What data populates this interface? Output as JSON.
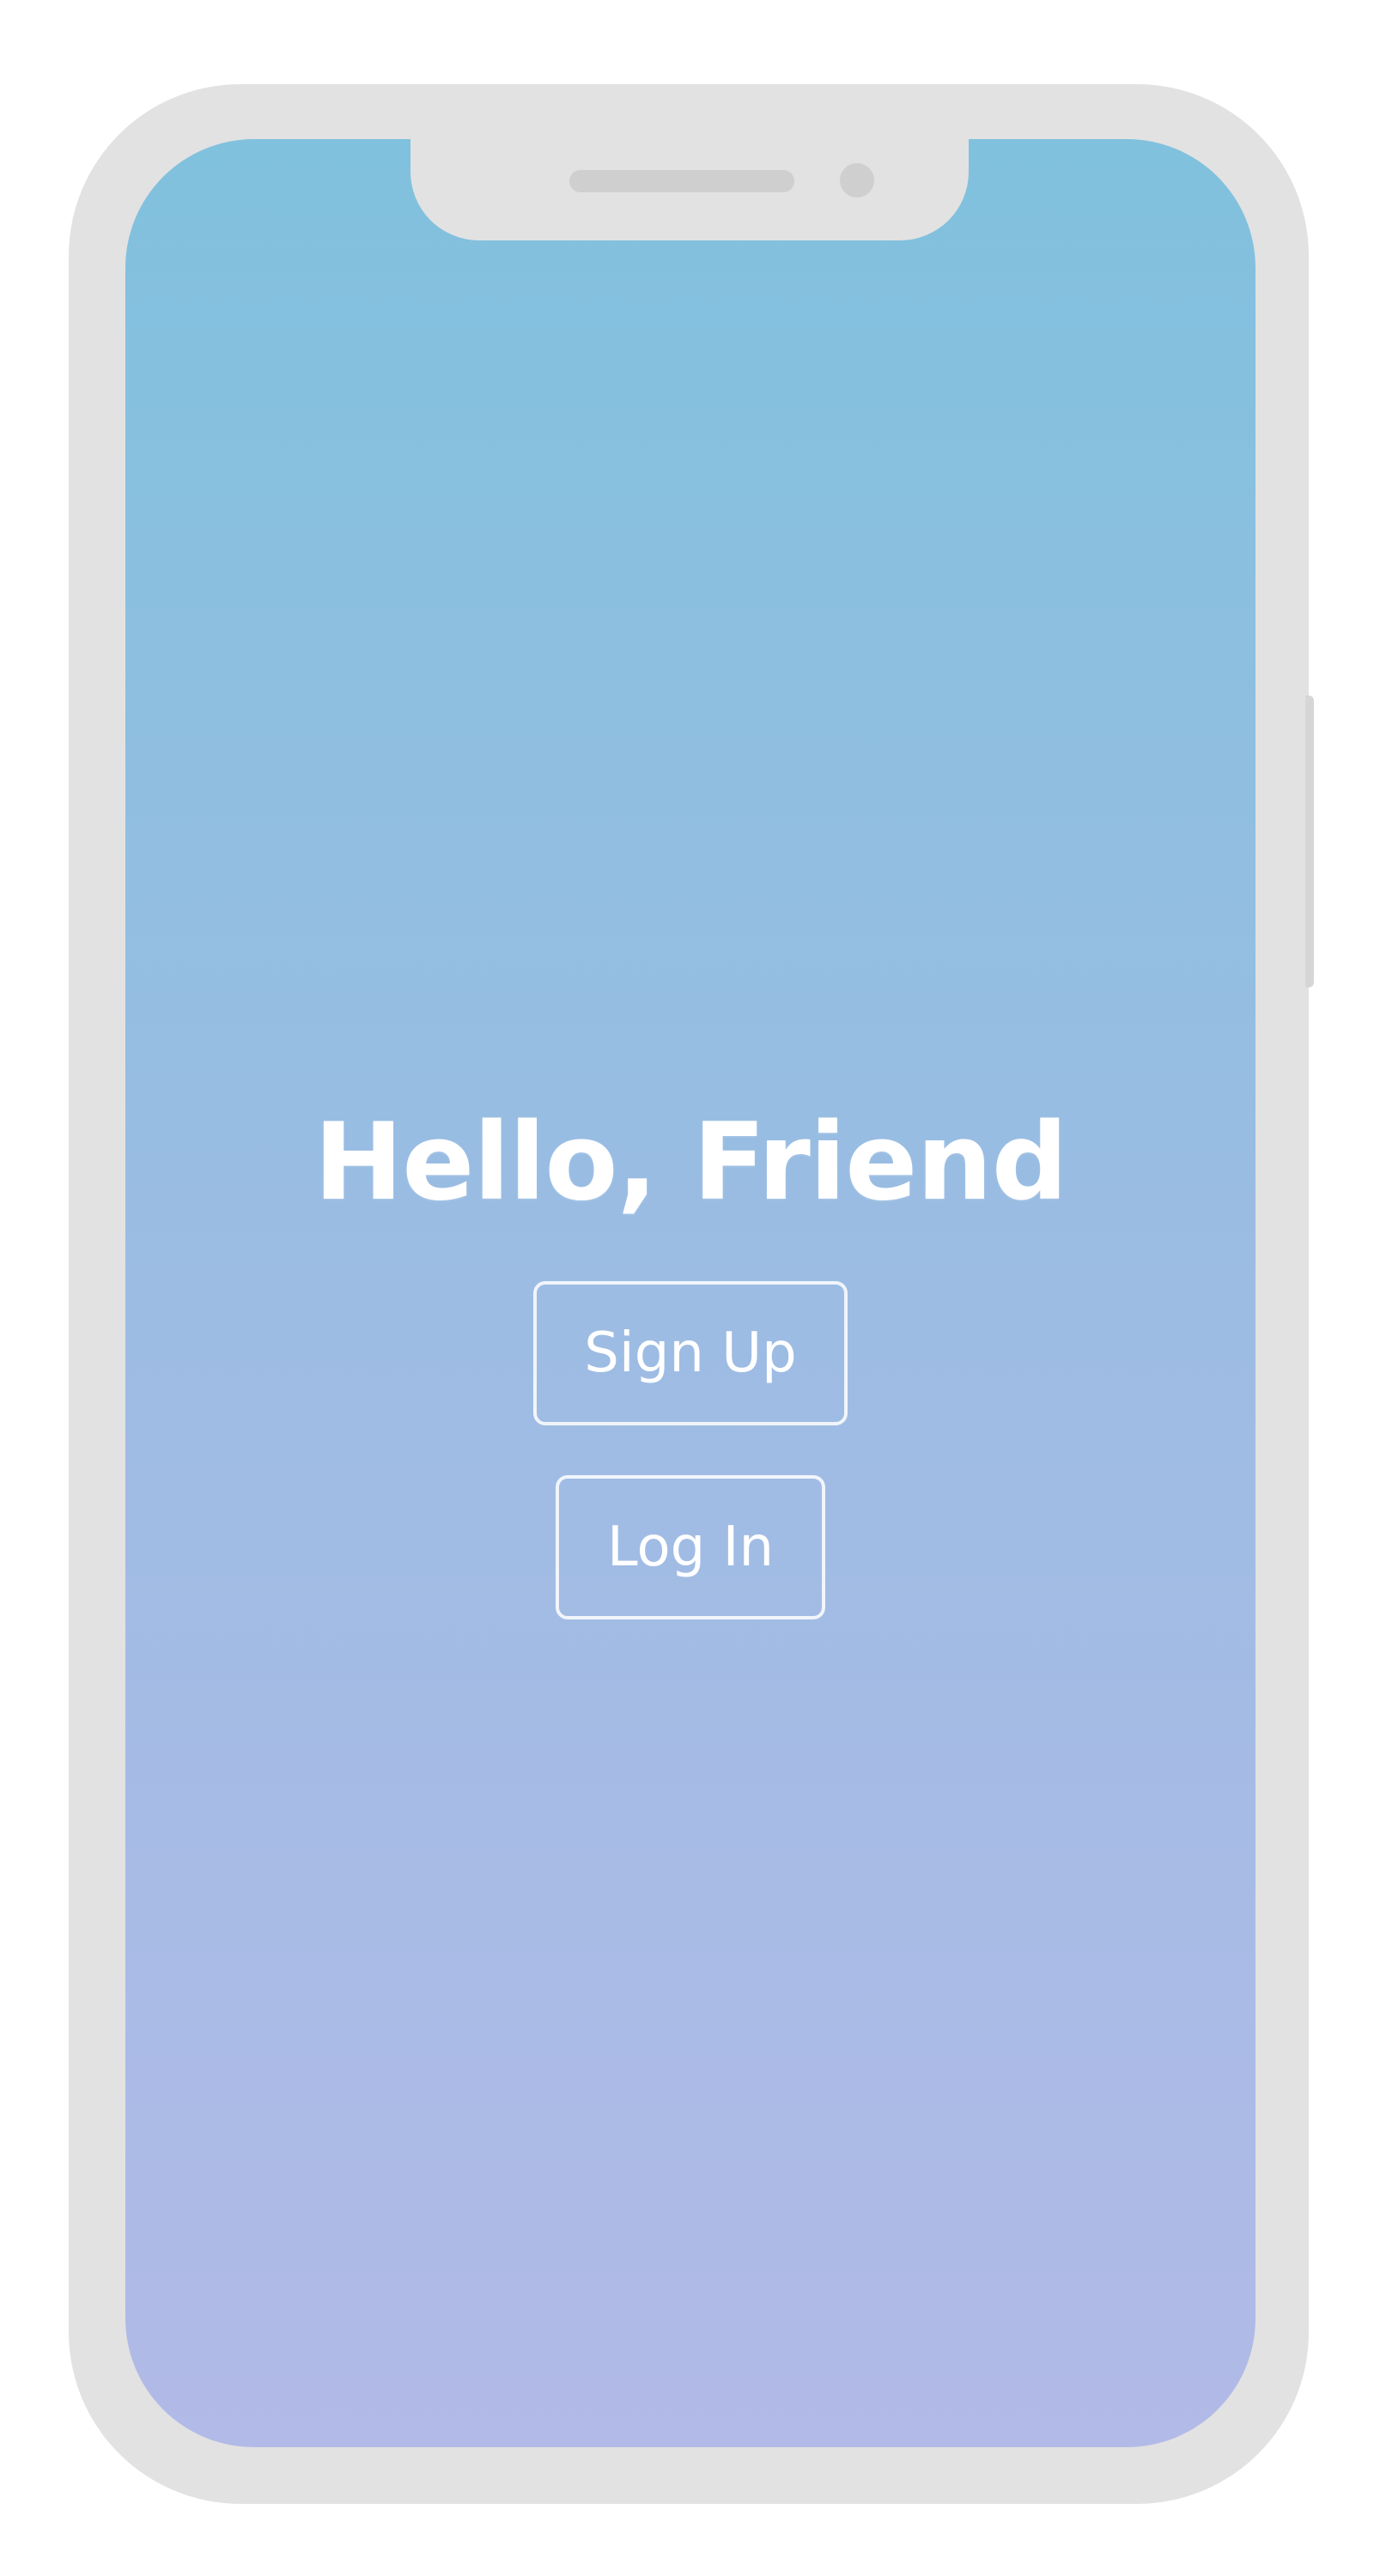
{
  "device": {
    "frame_color": "#e2e2e2",
    "screen_gradient": [
      "#80c1de",
      "#9cbce3",
      "#b2bae7"
    ]
  },
  "welcome": {
    "title": "Hello, Friend",
    "signup_label": "Sign Up",
    "login_label": "Log In"
  }
}
